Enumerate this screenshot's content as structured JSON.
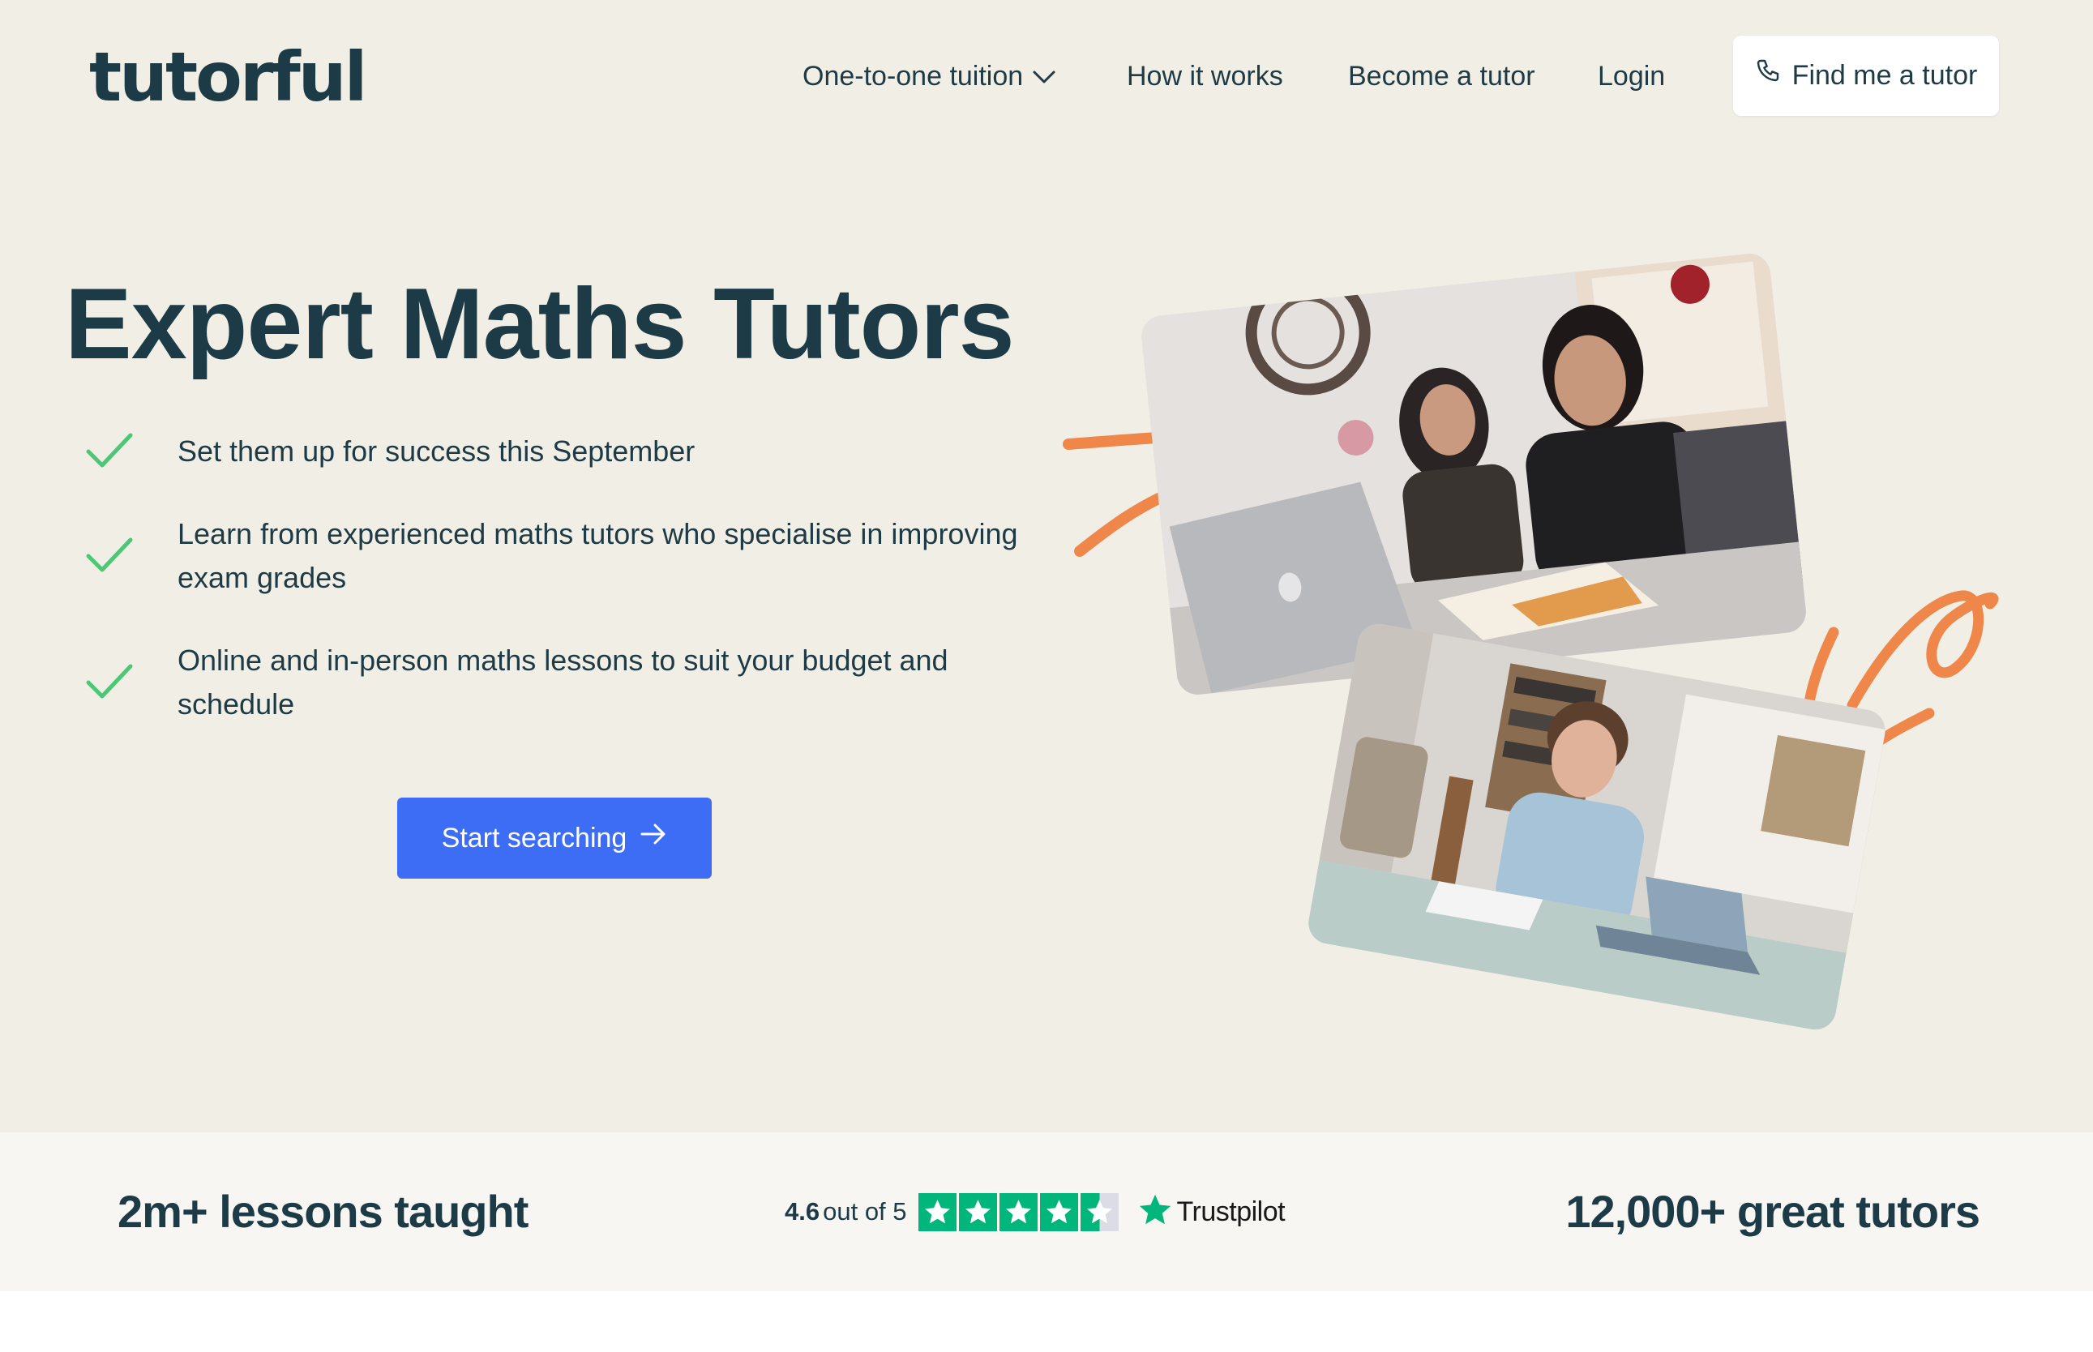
{
  "header": {
    "logo_text": "tutorful",
    "nav": [
      {
        "label": "One-to-one tuition",
        "has_dropdown": true
      },
      {
        "label": "How it works"
      },
      {
        "label": "Become a tutor"
      },
      {
        "label": "Login"
      }
    ],
    "cta": {
      "label": "Find me a tutor",
      "icon": "phone-icon"
    }
  },
  "hero": {
    "title": "Expert Maths Tutors",
    "bullets": [
      "Set them up for success this September",
      "Learn from experienced maths tutors who specialise in improving exam grades",
      "Online and in-person maths lessons to suit your budget and schedule"
    ],
    "start_button": "Start searching",
    "images": [
      {
        "alt": "photo-parent-and-student-with-laptop"
      },
      {
        "alt": "photo-student-at-table-with-laptop"
      }
    ]
  },
  "stats": {
    "lessons": "2m+ lessons taught",
    "rating_score": "4.6",
    "rating_out_of": "out of 5",
    "rating_value": 4.6,
    "rating_max": 5,
    "trustpilot": "Trustpilot",
    "tutors": "12,000+ great tutors"
  },
  "colors": {
    "hero_bg": "#f1efe5",
    "stats_bg": "#f7f6f2",
    "primary_text": "#1d3b47",
    "button_blue": "#3e6df5",
    "check_green": "#4bc776",
    "accent_orange": "#f0874a",
    "trustpilot_green": "#00b67a"
  }
}
